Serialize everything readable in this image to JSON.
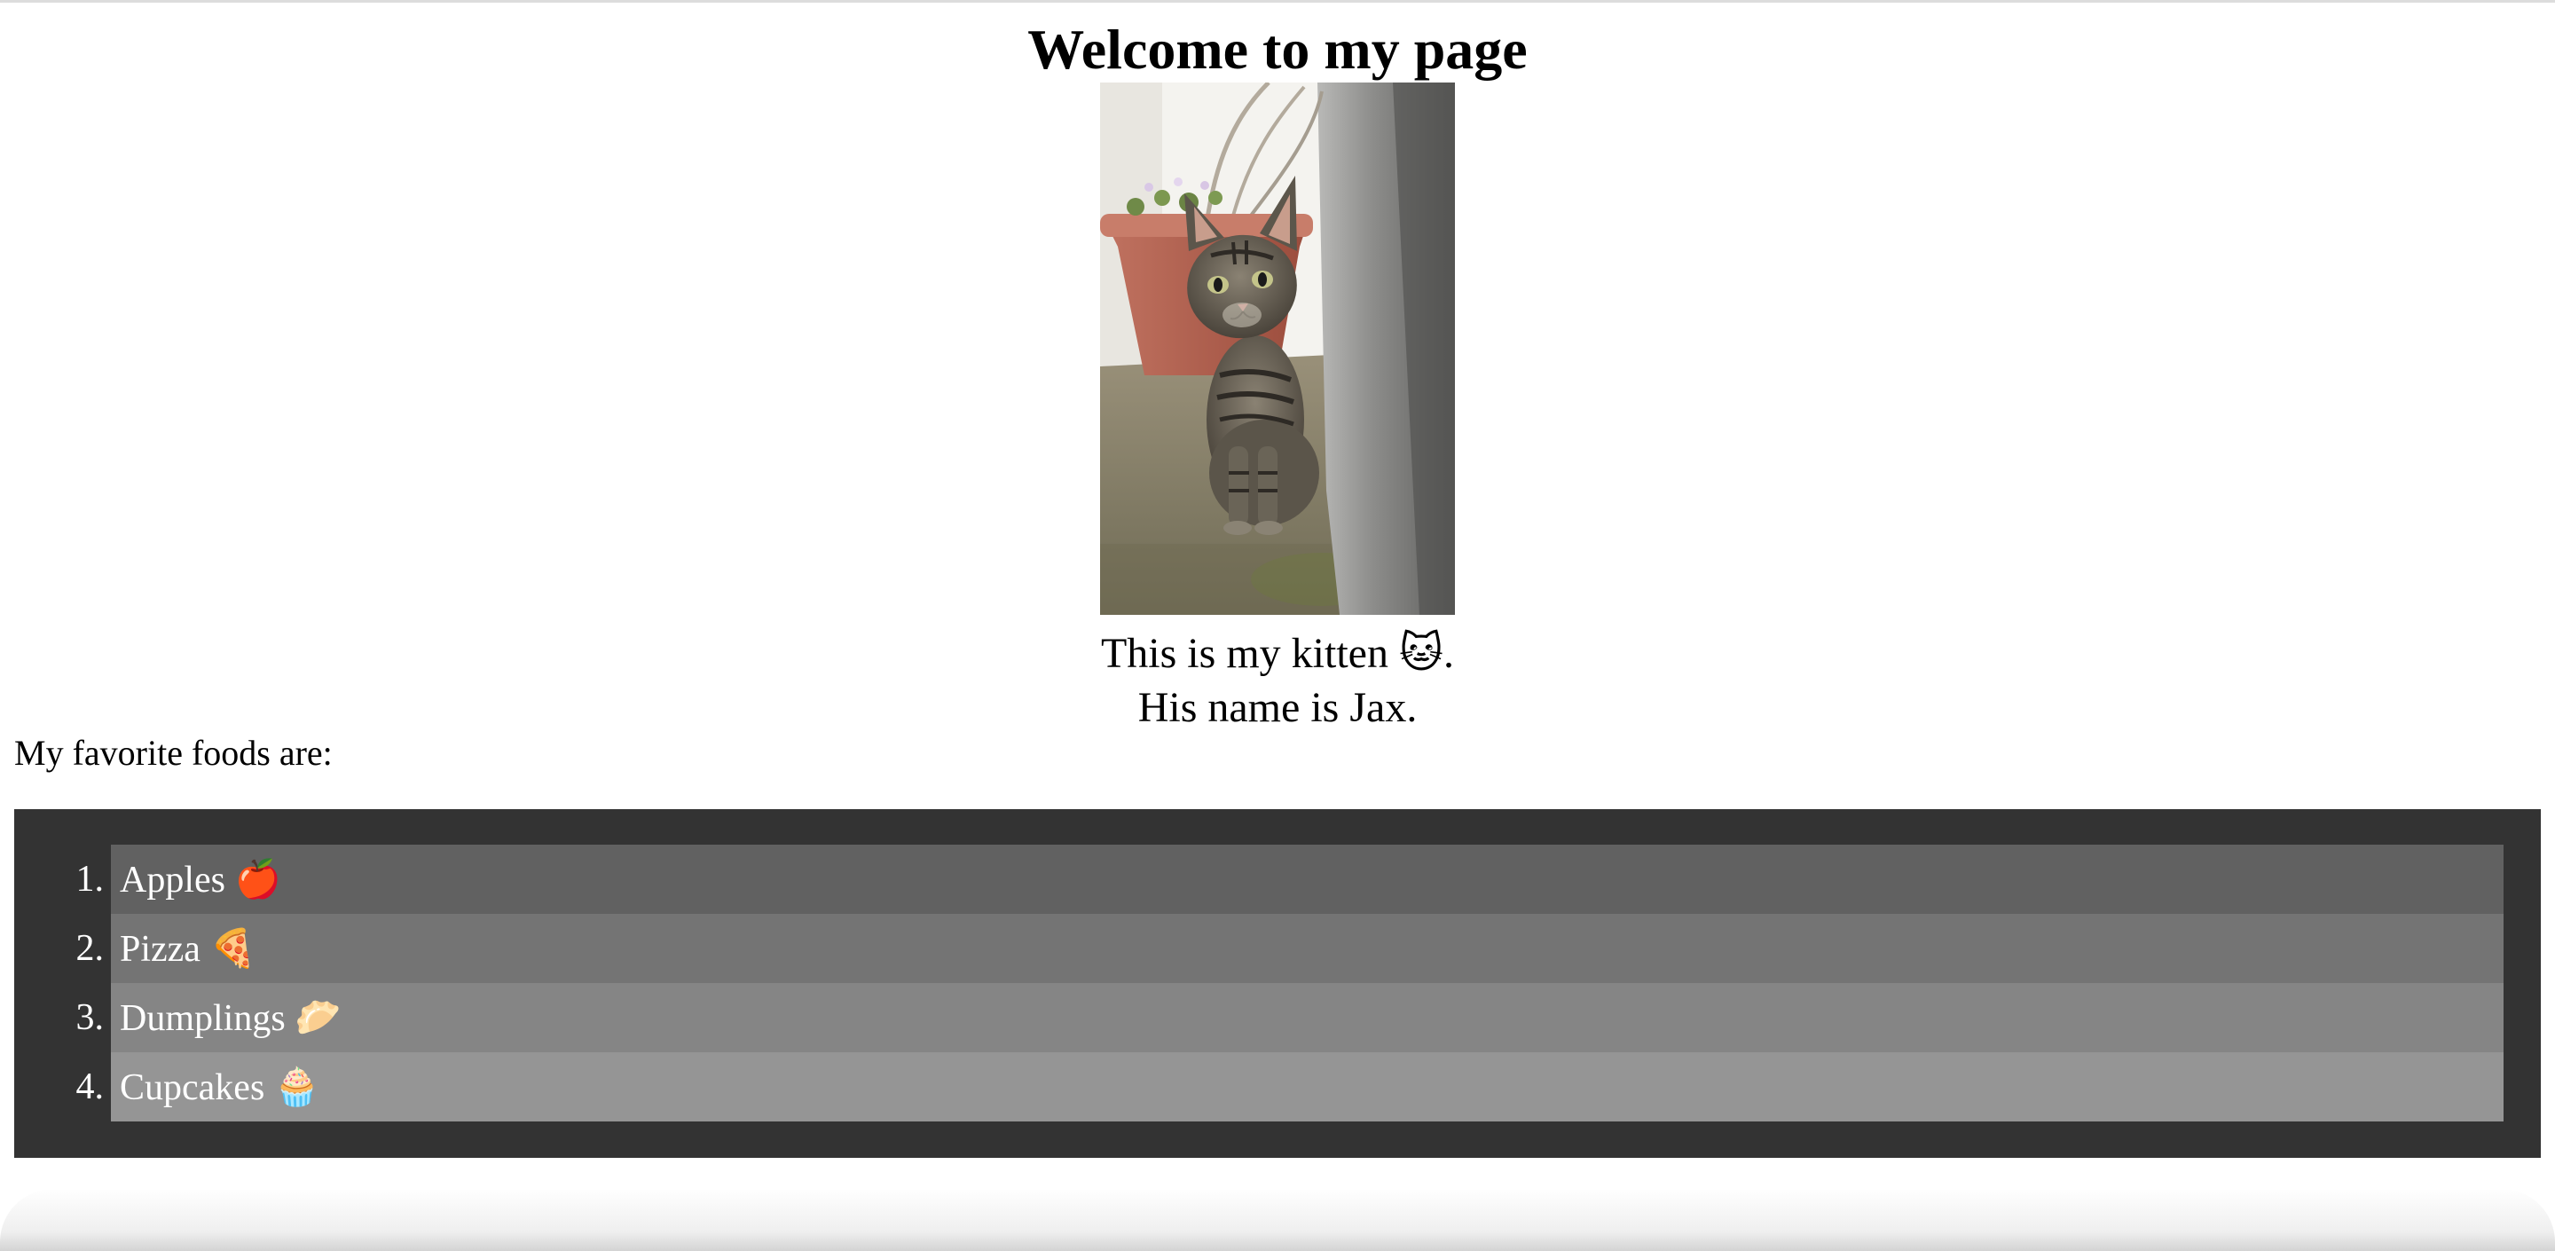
{
  "page": {
    "title": "Welcome to my page"
  },
  "kitten": {
    "photo_alt": "kitten",
    "caption_line1": "This is my kitten",
    "caption_emoji": "🐱",
    "caption_end": ".",
    "caption_line2": "His name is Jax."
  },
  "foods": {
    "intro": "My favorite foods are:",
    "items": [
      {
        "num": "1.",
        "label": "Apples",
        "emoji": "🍎",
        "bg": "#616161"
      },
      {
        "num": "2.",
        "label": "Pizza",
        "emoji": "🍕",
        "bg": "#747474"
      },
      {
        "num": "3.",
        "label": "Dumplings",
        "emoji": "🥟",
        "bg": "#858585"
      },
      {
        "num": "4.",
        "label": "Cupcakes",
        "emoji": "🧁",
        "bg": "#959595"
      }
    ],
    "panel_bg": "#333333"
  }
}
